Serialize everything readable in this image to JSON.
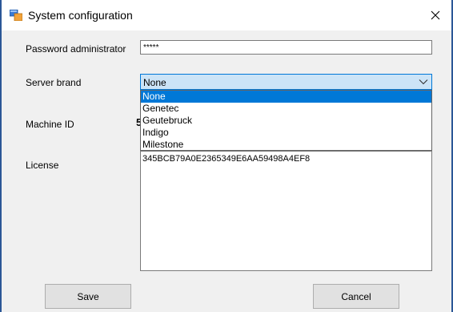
{
  "window": {
    "title": "System configuration",
    "close_glyph": "✕",
    "icon": "app-window-icon"
  },
  "form": {
    "password": {
      "label": "Password administrator",
      "value": "*****"
    },
    "server_brand": {
      "label": "Server brand",
      "selected": "None",
      "options": [
        "None",
        "Genetec",
        "Geutebruck",
        "Indigo",
        "Milestone"
      ],
      "highlighted_index": 0
    },
    "machine_id": {
      "label": "Machine ID",
      "value": "5"
    },
    "license": {
      "label": "License",
      "value": "345BCB79A0E2365349E6AA59498A4EF8"
    }
  },
  "buttons": {
    "save": "Save",
    "cancel": "Cancel"
  },
  "colors": {
    "selection": "#0078d7",
    "combo_bg": "#cce4f7",
    "window_border": "#2b5797"
  }
}
